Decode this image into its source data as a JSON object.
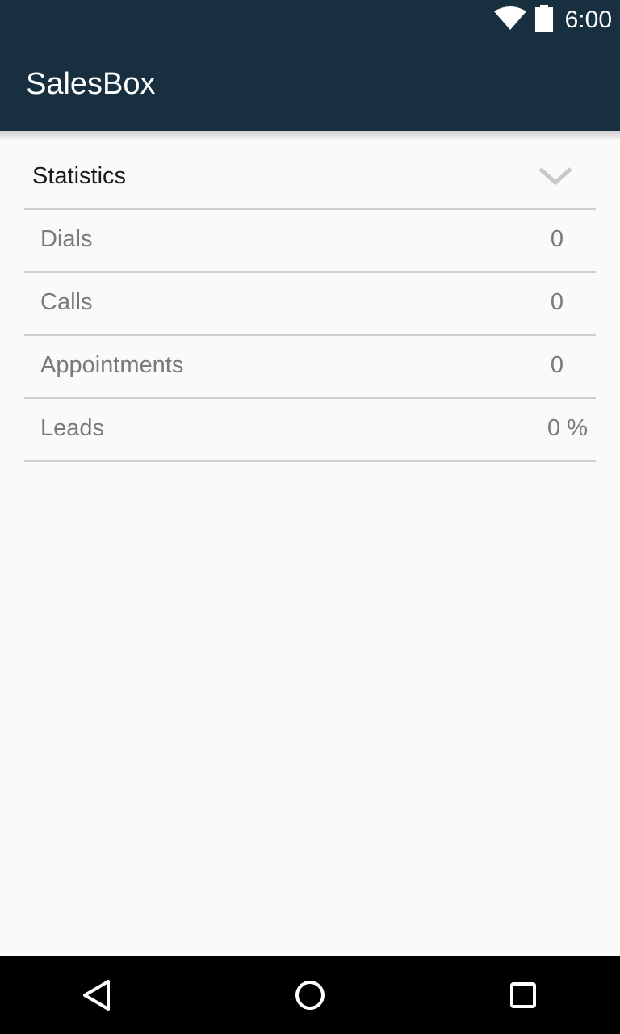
{
  "status_bar": {
    "time": "6:00",
    "icons": [
      "wifi-icon",
      "battery-icon"
    ]
  },
  "app_bar": {
    "title": "SalesBox",
    "background_color": "#172f3f"
  },
  "statistics": {
    "header": "Statistics",
    "expand_icon": "chevron-down-icon",
    "rows": [
      {
        "label": "Dials",
        "value": "0"
      },
      {
        "label": "Calls",
        "value": "0"
      },
      {
        "label": "Appointments",
        "value": "0"
      },
      {
        "label": "Leads",
        "value": "0 %"
      }
    ]
  },
  "nav_bar": {
    "icons": [
      "back-icon",
      "home-icon",
      "recents-icon"
    ]
  }
}
